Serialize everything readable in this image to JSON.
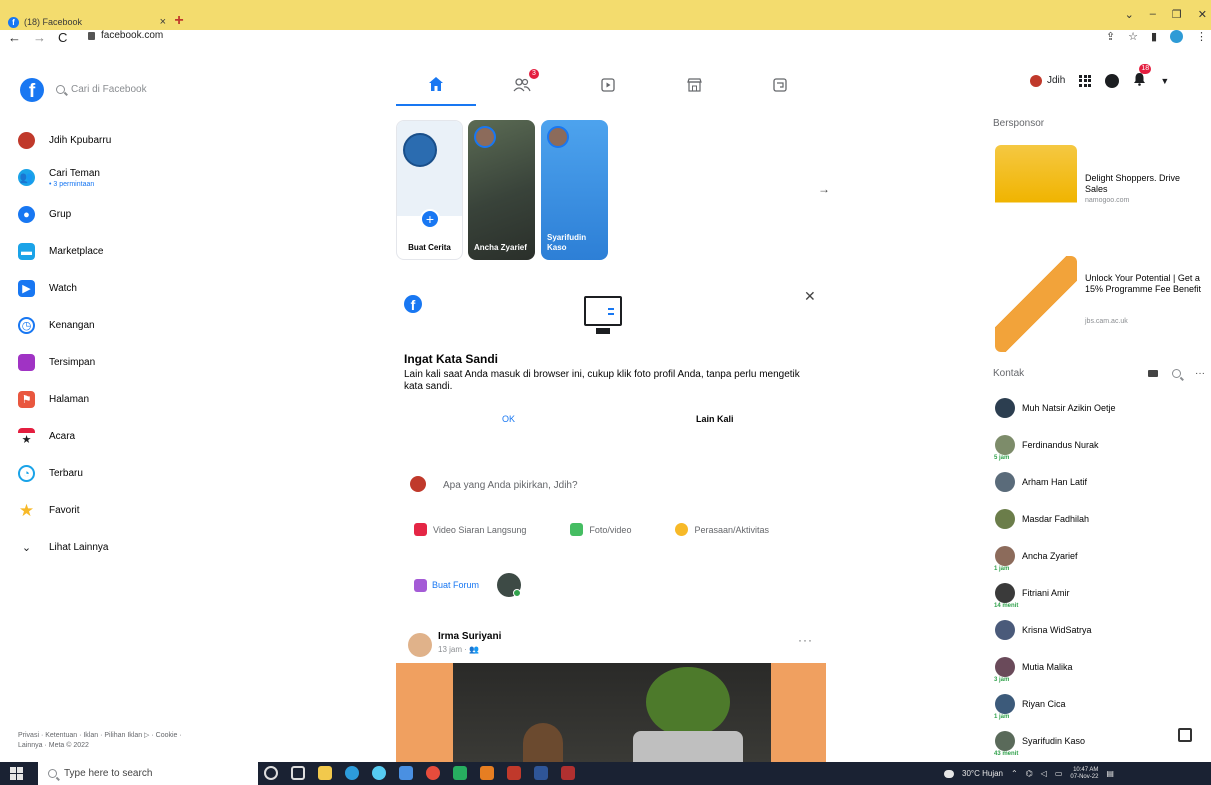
{
  "browser": {
    "tab_title": "(18) Facebook",
    "tab_close": "×",
    "new_tab": "+",
    "url": "facebook.com",
    "window_controls": [
      "⌄",
      "–",
      "❐",
      "✕"
    ]
  },
  "header": {
    "search_placeholder": "Cari di Facebook",
    "nav_badges": {
      "friends": "3"
    },
    "user_short": "Jdih",
    "notif_badge": "18"
  },
  "sidebar": {
    "items": [
      {
        "label": "Jdih Kpubarru",
        "sub": ""
      },
      {
        "label": "Cari Teman",
        "sub": "• 3 permintaan"
      },
      {
        "label": "Grup",
        "sub": ""
      },
      {
        "label": "Marketplace",
        "sub": ""
      },
      {
        "label": "Watch",
        "sub": ""
      },
      {
        "label": "Kenangan",
        "sub": ""
      },
      {
        "label": "Tersimpan",
        "sub": ""
      },
      {
        "label": "Halaman",
        "sub": ""
      },
      {
        "label": "Acara",
        "sub": ""
      },
      {
        "label": "Terbaru",
        "sub": ""
      },
      {
        "label": "Favorit",
        "sub": ""
      },
      {
        "label": "Lihat Lainnya",
        "sub": ""
      }
    ],
    "footer": "Privasi · Ketentuan · Iklan · Pilihan Iklan ▷ · Cookie · Lainnya · Meta © 2022"
  },
  "stories": {
    "create_label": "Buat Cerita",
    "items": [
      {
        "name": "Ancha Zyarief"
      },
      {
        "name": "Syarifudin Kaso"
      }
    ]
  },
  "remember": {
    "title": "Ingat Kata Sandi",
    "body": "Lain kali saat Anda masuk di browser ini, cukup klik foto profil Anda, tanpa perlu mengetik kata sandi.",
    "ok": "OK",
    "later": "Lain Kali"
  },
  "composer": {
    "placeholder": "Apa yang Anda pikirkan, Jdih?",
    "actions": [
      "Video Siaran Langsung",
      "Foto/video",
      "Perasaan/Aktivitas"
    ],
    "forum": "Buat Forum"
  },
  "post": {
    "author": "Irma Suriyani",
    "time": "13 jam · 👥",
    "more": "···"
  },
  "right": {
    "sponsored_title": "Bersponsor",
    "ads": [
      {
        "text": "Delight Shoppers. Drive Sales",
        "domain": "namogoo.com"
      },
      {
        "text": "Unlock Your Potential | Get a 15% Programme Fee Benefit",
        "domain": "jbs.cam.ac.uk"
      }
    ],
    "contacts_title": "Kontak",
    "contacts_more": "···",
    "contacts": [
      {
        "name": "Muh Natsir Azikin Oetje",
        "status": ""
      },
      {
        "name": "Ferdinandus Nurak",
        "status": "5 jam"
      },
      {
        "name": "Arham Han Latif",
        "status": ""
      },
      {
        "name": "Masdar Fadhilah",
        "status": ""
      },
      {
        "name": "Ancha Zyarief",
        "status": "1 jam"
      },
      {
        "name": "Fitriani Amir",
        "status": "14 menit"
      },
      {
        "name": "Krisna WidSatrya",
        "status": ""
      },
      {
        "name": "Mutia Malika",
        "status": "3 jam"
      },
      {
        "name": "Riyan Cica",
        "status": "1 jam"
      },
      {
        "name": "Syarifudin Kaso",
        "status": "43 menit"
      }
    ]
  },
  "taskbar": {
    "search_placeholder": "Type here to search",
    "weather": "30°C Hujan",
    "time": "10:47 AM",
    "date": "07-Nov-22"
  },
  "colors": {
    "brand": "#1877f2",
    "tabstrip": "#f3dc6e",
    "taskbar": "#1a2233",
    "badge": "#e41e3f"
  }
}
